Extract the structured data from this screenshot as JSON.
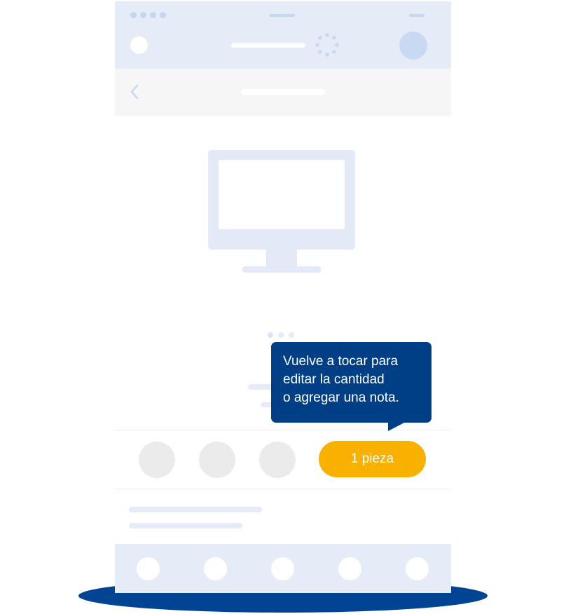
{
  "colors": {
    "accent": "#f9b100",
    "tooltip_bg": "#003f86",
    "skeleton": "#e6ebf8",
    "shadow": "#004493"
  },
  "icons": {
    "back": "chevron-left-icon",
    "loading": "spinner-icon",
    "illustration": "monitor-icon"
  },
  "tooltip": {
    "lines": [
      "Vuelve a tocar para",
      "editar la cantidad",
      "o agregar una nota."
    ]
  },
  "quantity": {
    "label": "1 pieza"
  }
}
